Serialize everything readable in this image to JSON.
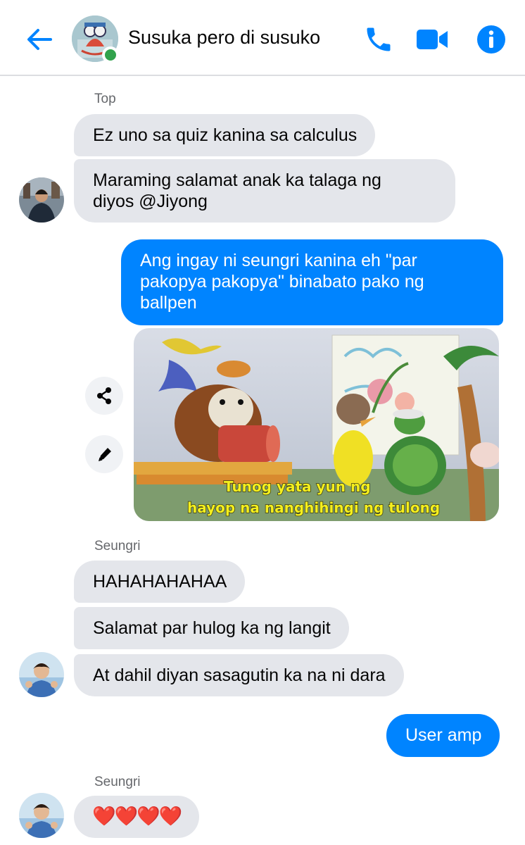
{
  "header": {
    "title": "Susuka pero di susuko",
    "accent_color": "#0084ff",
    "online_color": "#31a24c",
    "icons": [
      "back-arrow-icon",
      "phone-icon",
      "video-camera-icon",
      "info-icon"
    ]
  },
  "messages": {
    "group1": {
      "sender": "Top",
      "m1": "Ez uno sa quiz kanina sa calculus",
      "m2_line1": "Maraming salamat anak ka talaga ng",
      "m2_line2": "diyos @Jiyong"
    },
    "outgoing1": {
      "line1": "Ang ingay ni seungri kanina eh \"par",
      "line2": "pakopya pakopya\" binabato pako ng",
      "line3": "ballpen"
    },
    "image": {
      "caption_line1": "Tunog yata yun ng",
      "caption_line2": "hayop na nanghihingi ng tulong"
    },
    "group2": {
      "sender": "Seungri",
      "m1": "HAHAHAHAHAA",
      "m2": "Salamat par hulog ka ng langit",
      "m3": "At dahil diyan sasagutin ka na ni dara"
    },
    "outgoing2": "User amp",
    "group3": {
      "sender": "Seungri",
      "m1": "❤️❤️❤️❤️"
    }
  }
}
